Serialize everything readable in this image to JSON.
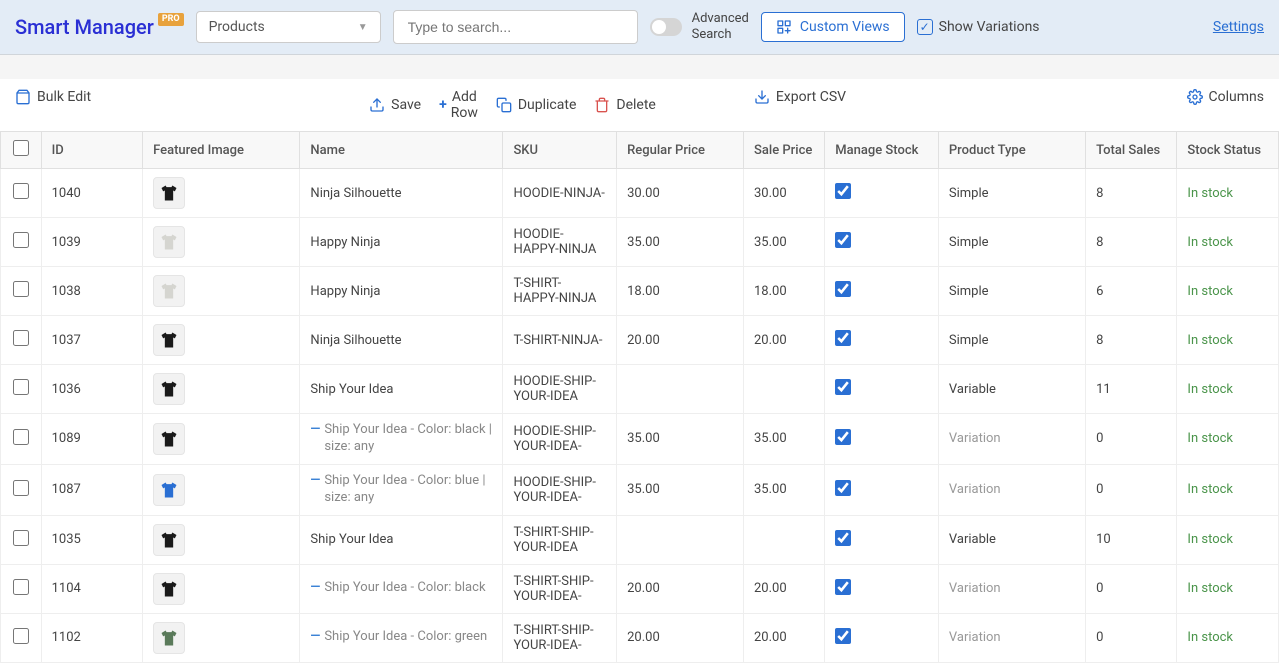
{
  "brand": {
    "name": "Smart Manager",
    "badge": "PRO"
  },
  "dropdown": {
    "selected": "Products"
  },
  "search": {
    "placeholder": "Type to search..."
  },
  "advanced_search": "Advanced Search",
  "custom_views": "Custom Views",
  "show_variations": "Show Variations",
  "settings": "Settings",
  "toolbar": {
    "bulk_edit": "Bulk Edit",
    "save": "Save",
    "add_row": "Add Row",
    "duplicate": "Duplicate",
    "delete": "Delete",
    "export_csv": "Export CSV",
    "columns": "Columns"
  },
  "columns": [
    "ID",
    "Featured Image",
    "Name",
    "SKU",
    "Regular Price",
    "Sale Price",
    "Manage Stock",
    "Product Type",
    "Total Sales",
    "Stock Status"
  ],
  "rows": [
    {
      "id": "1040",
      "thumb_bg": "#f2f2f2",
      "thumb_glyph": "👕",
      "thumb_color": "#1a1a1a",
      "name": "Ninja Silhouette",
      "variation": false,
      "sku": "HOODIE-NINJA-",
      "rprice": "30.00",
      "sprice": "30.00",
      "mstock": true,
      "ptype": "Simple",
      "ptype_variation": false,
      "sales": "8",
      "status": "In stock"
    },
    {
      "id": "1039",
      "thumb_bg": "#f2f2f2",
      "thumb_glyph": "👕",
      "thumb_color": "#d5d5d0",
      "name": "Happy Ninja",
      "variation": false,
      "sku": "HOODIE-HAPPY-NINJA",
      "rprice": "35.00",
      "sprice": "35.00",
      "mstock": true,
      "ptype": "Simple",
      "ptype_variation": false,
      "sales": "8",
      "status": "In stock"
    },
    {
      "id": "1038",
      "thumb_bg": "#f2f2f2",
      "thumb_glyph": "👕",
      "thumb_color": "#d5d5d0",
      "name": "Happy Ninja",
      "variation": false,
      "sku": "T-SHIRT-HAPPY-NINJA",
      "rprice": "18.00",
      "sprice": "18.00",
      "mstock": true,
      "ptype": "Simple",
      "ptype_variation": false,
      "sales": "6",
      "status": "In stock"
    },
    {
      "id": "1037",
      "thumb_bg": "#f2f2f2",
      "thumb_glyph": "👕",
      "thumb_color": "#1a1a1a",
      "name": "Ninja Silhouette",
      "variation": false,
      "sku": "T-SHIRT-NINJA-",
      "rprice": "20.00",
      "sprice": "20.00",
      "mstock": true,
      "ptype": "Simple",
      "ptype_variation": false,
      "sales": "8",
      "status": "In stock"
    },
    {
      "id": "1036",
      "thumb_bg": "#f2f2f2",
      "thumb_glyph": "👕",
      "thumb_color": "#1a1a1a",
      "name": "Ship Your Idea",
      "variation": false,
      "sku": "HOODIE-SHIP-YOUR-IDEA",
      "rprice": "",
      "sprice": "",
      "mstock": true,
      "ptype": "Variable",
      "ptype_variation": false,
      "sales": "11",
      "status": "In stock"
    },
    {
      "id": "1089",
      "thumb_bg": "#f2f2f2",
      "thumb_glyph": "👕",
      "thumb_color": "#1a1a1a",
      "name": "Ship Your Idea - Color: black | size: any",
      "variation": true,
      "sku": "HOODIE-SHIP-YOUR-IDEA-",
      "rprice": "35.00",
      "sprice": "35.00",
      "mstock": true,
      "ptype": "Variation",
      "ptype_variation": true,
      "sales": "0",
      "status": "In stock"
    },
    {
      "id": "1087",
      "thumb_bg": "#f2f2f2",
      "thumb_glyph": "👕",
      "thumb_color": "#2a6fd3",
      "name": "Ship Your Idea - Color: blue | size: any",
      "variation": true,
      "sku": "HOODIE-SHIP-YOUR-IDEA-",
      "rprice": "35.00",
      "sprice": "35.00",
      "mstock": true,
      "ptype": "Variation",
      "ptype_variation": true,
      "sales": "0",
      "status": "In stock"
    },
    {
      "id": "1035",
      "thumb_bg": "#f2f2f2",
      "thumb_glyph": "👕",
      "thumb_color": "#1a1a1a",
      "name": "Ship Your Idea",
      "variation": false,
      "sku": "T-SHIRT-SHIP-YOUR-IDEA",
      "rprice": "",
      "sprice": "",
      "mstock": true,
      "ptype": "Variable",
      "ptype_variation": false,
      "sales": "10",
      "status": "In stock"
    },
    {
      "id": "1104",
      "thumb_bg": "#f2f2f2",
      "thumb_glyph": "👕",
      "thumb_color": "#1a1a1a",
      "name": "Ship Your Idea - Color: black",
      "variation": true,
      "sku": "T-SHIRT-SHIP-YOUR-IDEA-",
      "rprice": "20.00",
      "sprice": "20.00",
      "mstock": true,
      "ptype": "Variation",
      "ptype_variation": true,
      "sales": "0",
      "status": "In stock"
    },
    {
      "id": "1102",
      "thumb_bg": "#f2f2f2",
      "thumb_glyph": "👕",
      "thumb_color": "#5a7a5a",
      "name": "Ship Your Idea - Color: green",
      "variation": true,
      "sku": "T-SHIRT-SHIP-YOUR-IDEA-",
      "rprice": "20.00",
      "sprice": "20.00",
      "mstock": true,
      "ptype": "Variation",
      "ptype_variation": true,
      "sales": "0",
      "status": "In stock"
    }
  ]
}
